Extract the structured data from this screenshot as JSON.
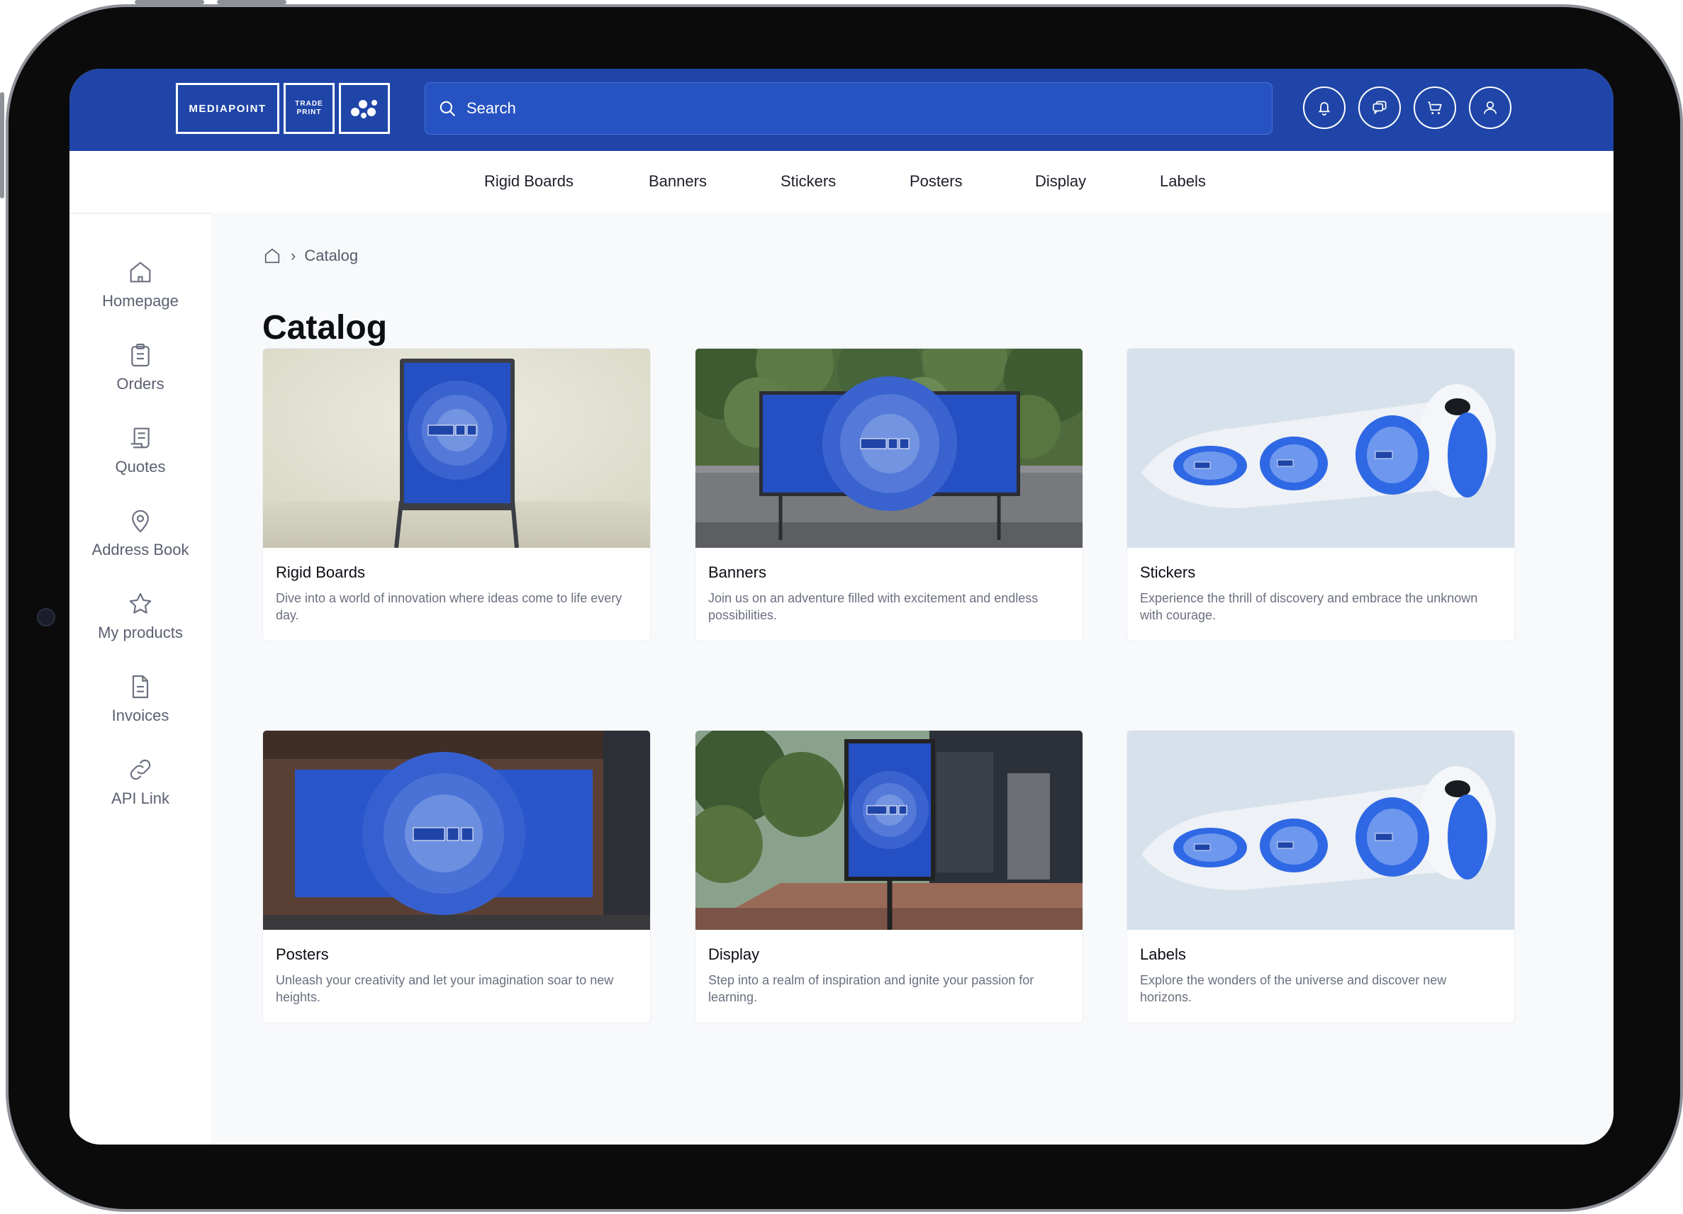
{
  "app": {
    "brand": "MEDIAPOINT",
    "brand_sub": "TRADE\nPRINT"
  },
  "search": {
    "placeholder": "Search"
  },
  "topbar_icons": [
    "bell-icon",
    "chat-icon",
    "cart-icon",
    "user-icon"
  ],
  "nav": {
    "items": [
      "Rigid Boards",
      "Banners",
      "Stickers",
      "Posters",
      "Display",
      "Labels"
    ]
  },
  "sidebar": {
    "items": [
      {
        "label": "Homepage",
        "icon": "home-icon"
      },
      {
        "label": "Orders",
        "icon": "clipboard-icon"
      },
      {
        "label": "Quotes",
        "icon": "quote-doc-icon"
      },
      {
        "label": "Address Book",
        "icon": "map-pin-icon"
      },
      {
        "label": "My products",
        "icon": "star-icon"
      },
      {
        "label": "Invoices",
        "icon": "invoice-icon"
      },
      {
        "label": "API Link",
        "icon": "link-icon"
      }
    ]
  },
  "breadcrumb": {
    "current": "Catalog"
  },
  "page": {
    "title": "Catalog"
  },
  "cards": [
    {
      "title": "Rigid Boards",
      "desc": "Dive into a world of innovation where ideas come to life every day."
    },
    {
      "title": "Banners",
      "desc": "Join us on an adventure filled with excitement and endless possibilities."
    },
    {
      "title": "Stickers",
      "desc": "Experience the thrill of discovery and embrace the unknown with courage."
    },
    {
      "title": "Posters",
      "desc": "Unleash your creativity and let your imagination soar to new heights."
    },
    {
      "title": "Display",
      "desc": "Step into a realm of inspiration and ignite your passion for learning."
    },
    {
      "title": "Labels",
      "desc": "Explore the wonders of the universe and discover new horizons."
    }
  ],
  "colors": {
    "brand_blue": "#1f45a8",
    "background": "#f8f9fb",
    "text_dark": "#0c0e14",
    "text_muted": "#6b7080"
  }
}
